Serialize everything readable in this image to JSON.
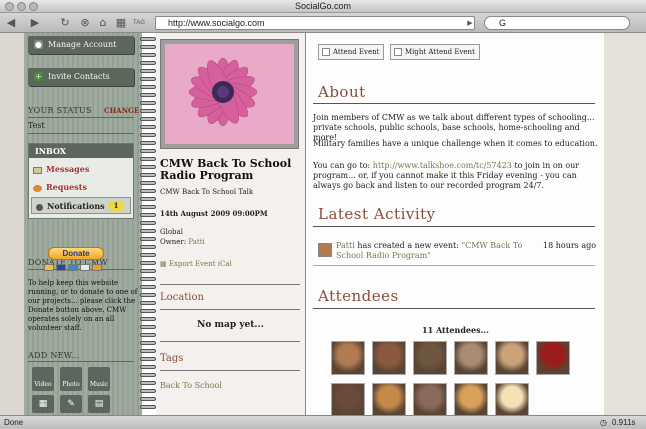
{
  "window": {
    "title": "SocialGo.com"
  },
  "browser": {
    "url": "http://www.socialgo.com",
    "search_value": "G",
    "status": "Done",
    "timing": "0.911s",
    "tag_label": "TAG"
  },
  "sidebar": {
    "manage_account": "Manage Account",
    "invite_contacts": "Invite Contacts",
    "your_status": "YOUR STATUS",
    "change": "CHANGE",
    "status_text": "Test",
    "inbox": "INBOX",
    "messages": "Messages",
    "requests": "Requests",
    "notifications": "Notifications",
    "notification_count": "1",
    "donate_heading": "DONATE TO CMW",
    "donate_button": "Donate",
    "donate_text": "To help keep this website running, or to donate to one of our projects... please click the Donate button above.  CMW operates solely on an all volunteer staff.",
    "add_new": "ADD NEW...",
    "add_items": [
      "Video",
      "Photo",
      "Music"
    ]
  },
  "event": {
    "title": "CMW Back To School Radio Program",
    "subtitle": "CMW Back To School Talk",
    "date": "14th August 2009 09:00PM",
    "scope": "Global",
    "owner_label": "Owner:",
    "owner": "Patti",
    "export": "Export Event iCal",
    "location_heading": "Location",
    "no_map": "No map yet...",
    "tags_heading": "Tags",
    "tag": "Back To School"
  },
  "actions": {
    "attend": "Attend Event",
    "might_attend": "Might Attend Event"
  },
  "about": {
    "heading": "About",
    "p1": "Join members of CMW as we talk about different types of schooling... private schools, public schools, base schools, home-schooling and more!",
    "p2": "Military families have a unique challenge when it comes to education.",
    "p3_prefix": "You can go to: ",
    "p3_link": "http://www.talkshoe.com/tc/57423",
    "p3_suffix": " to join in on our program... or, if you cannot make it this Friday evening - you can always go back and listen to our recorded program 24/7."
  },
  "activity": {
    "heading": "Latest Activity",
    "user": "Patti",
    "text": " has created a new event: ",
    "event_link": "\"CMW Back To School Radio Program\"",
    "time": "18 hours ago"
  },
  "attendees": {
    "heading": "Attendees",
    "count_text": "11 Attendees...",
    "avatar_colors": [
      "#b07a52",
      "#8a5a3e",
      "#6e5640",
      "#a98c72",
      "#c9a27a",
      "#9b1c1c",
      "#6a4a3a",
      "#c58a4a",
      "#8a6a5a",
      "#d9a05a",
      "#f4e2b6"
    ]
  },
  "colors": {
    "accent": "#8a4c3a",
    "sidebar": "#9aa79a",
    "link": "#6b7e4a"
  }
}
